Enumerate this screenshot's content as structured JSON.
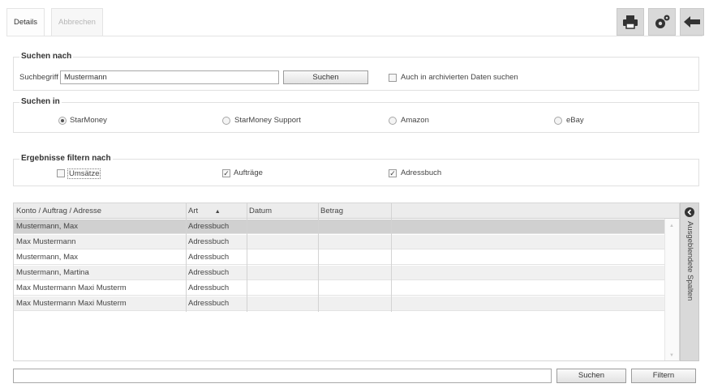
{
  "tabs": [
    {
      "label": "Details",
      "state": "active"
    },
    {
      "label": "Abbrechen",
      "state": "disabled"
    }
  ],
  "toolbar": {
    "print_icon": "print-icon",
    "settings_icon": "settings-gears-icon",
    "back_icon": "back-arrow-icon"
  },
  "search_by": {
    "legend": "Suchen nach",
    "term_label": "Suchbegriff",
    "term_value": "Mustermann",
    "search_button": "Suchen",
    "archive_label": "Auch in archivierten Daten suchen",
    "archive_checked": false
  },
  "search_in": {
    "legend": "Suchen in",
    "options": [
      {
        "label": "StarMoney",
        "selected": true
      },
      {
        "label": "StarMoney Support",
        "selected": false
      },
      {
        "label": "Amazon",
        "selected": false
      },
      {
        "label": "eBay",
        "selected": false
      }
    ]
  },
  "filter": {
    "legend": "Ergebnisse filtern nach",
    "options": [
      {
        "label": "Umsätze",
        "checked": false,
        "mark": ""
      },
      {
        "label": "Aufträge",
        "checked": true,
        "mark": "✓"
      },
      {
        "label": "Adressbuch",
        "checked": true,
        "mark": "✓"
      }
    ]
  },
  "table": {
    "columns": [
      "Konto / Auftrag / Adresse",
      "Art",
      "Datum",
      "Betrag"
    ],
    "sort_indicator": "▲",
    "rows": [
      {
        "name": "Mustermann, Max",
        "art": "Adressbuch",
        "datum": "",
        "betrag": ""
      },
      {
        "name": "Max Mustermann",
        "art": "Adressbuch",
        "datum": "",
        "betrag": ""
      },
      {
        "name": "Mustermann, Max",
        "art": "Adressbuch",
        "datum": "",
        "betrag": ""
      },
      {
        "name": "Mustermann, Martina",
        "art": "Adressbuch",
        "datum": "",
        "betrag": ""
      },
      {
        "name": "Max Mustermann Maxi Musterm",
        "art": "Adressbuch",
        "datum": "",
        "betrag": ""
      },
      {
        "name": "Max Mustermann Maxi Musterm",
        "art": "Adressbuch",
        "datum": "",
        "betrag": ""
      }
    ]
  },
  "side_panel": {
    "label": "Ausgeblendete Spalten",
    "icon": "collapse-chevron-icon"
  },
  "bottom": {
    "filter_value": "",
    "search_button": "Suchen",
    "filter_button": "Filtern"
  },
  "colors": {
    "selected_row": "#d0d0d0",
    "alt_row": "#f0f0f0",
    "toolbar_button": "#d9d9d9"
  }
}
